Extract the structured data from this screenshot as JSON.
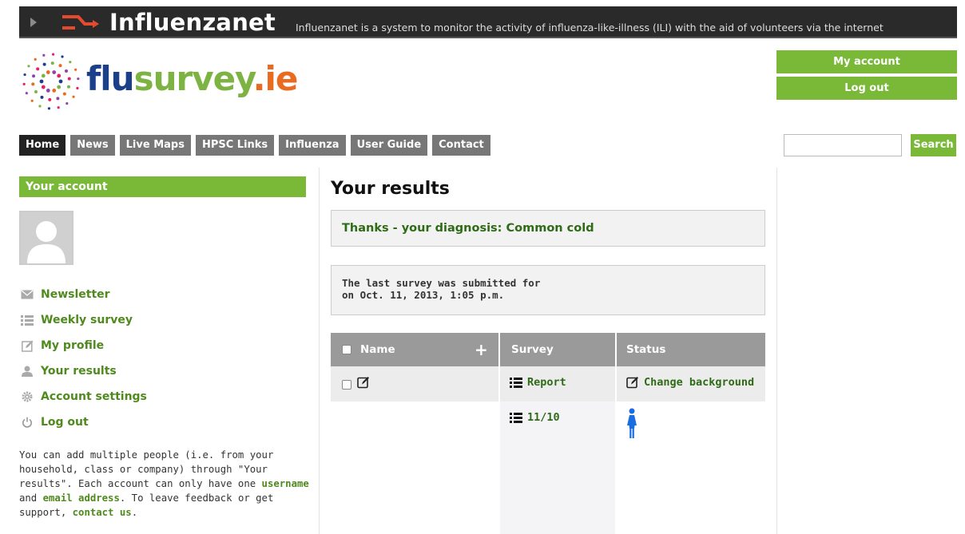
{
  "header": {
    "brand": "Influenzanet",
    "tagline": "Influenzanet is a system to monitor the activity of influenza-like-illness (ILI) with the aid of volunteers via the internet"
  },
  "logo": {
    "part1": "flu",
    "part2": "survey",
    "part3": ".ie"
  },
  "account_buttons": {
    "my_account": "My account",
    "log_out": "Log out"
  },
  "nav": {
    "items": [
      "Home",
      "News",
      "Live Maps",
      "HPSC Links",
      "Influenza",
      "User Guide",
      "Contact"
    ],
    "active": "Home"
  },
  "search": {
    "button": "Search",
    "value": ""
  },
  "sidebar": {
    "header": "Your account",
    "menu": [
      {
        "label": "Newsletter",
        "icon": "envelope-icon"
      },
      {
        "label": "Weekly survey",
        "icon": "list-icon"
      },
      {
        "label": "My profile",
        "icon": "edit-icon"
      },
      {
        "label": "Your results",
        "icon": "user-icon"
      },
      {
        "label": "Account settings",
        "icon": "gear-icon"
      },
      {
        "label": "Log out",
        "icon": "power-icon"
      }
    ],
    "info": {
      "t1": "You can add multiple people (i.e. from your household, class or company) through \"Your results\". Each account can only have one ",
      "l1": "username",
      "t2": " and ",
      "l2": "email address",
      "t3": ". To leave feedback or get support, ",
      "l3": "contact us",
      "t4": "."
    }
  },
  "main": {
    "title": "Your results",
    "diagnosis": "Thanks - your diagnosis: Common cold",
    "last_line1": "The last survey was submitted for",
    "last_line2": "on Oct. 11, 2013, 1:05 p.m.",
    "table": {
      "headers": {
        "name": "Name",
        "survey": "Survey",
        "status": "Status"
      },
      "row1": {
        "survey": "Report",
        "status": "Change background"
      },
      "row2": {
        "survey": "11/10"
      }
    }
  },
  "colors": {
    "green": "#7ab838",
    "dark_green": "#4e8a1c",
    "nav_gray": "#777777",
    "active_nav": "#222222"
  }
}
